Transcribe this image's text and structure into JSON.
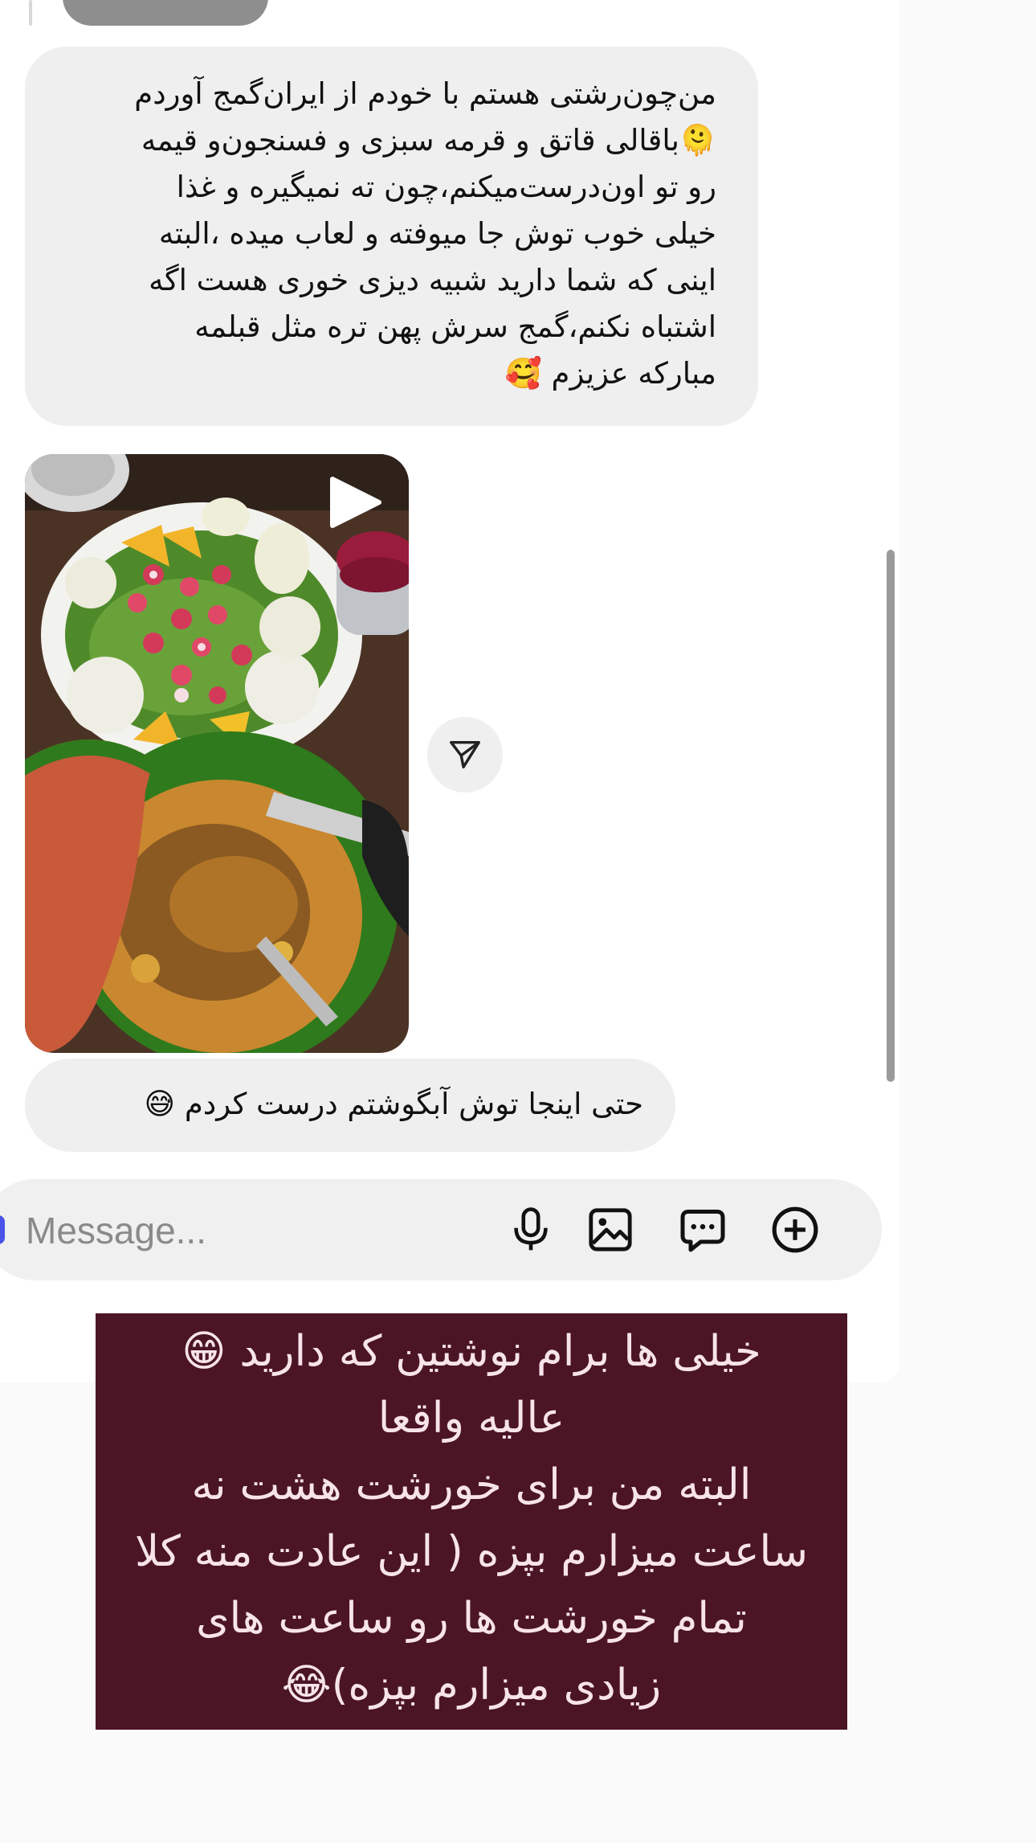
{
  "chat": {
    "messages": [
      {
        "text": "من‌چون‌رشتی هستم با خودم از ایران‌گمج آوردم\n🫠باقالی قاتق و قرمه سبزی و فسنجون‌و قیمه\nرو تو اون‌درست‌میکنم،چون ته نمیگیره و غذا\nخیلی خوب توش جا میوفته و لعاب میده ،البته\nاینی که شما دارید شبیه دیزی خوری هست اگه\nاشتباه نکنم،گمج سرش پهن تره مثل قبلمه\nمبارکه عزیزم 🥰"
      },
      {
        "text": "حتی اینجا توش آبگوشتم درست کردم 😅"
      }
    ],
    "video": {
      "icon": "play-icon",
      "colors": {
        "table": "#4a3325",
        "salad_plate": "#f2f2ee",
        "green_bowl": "#2f7a1c",
        "rice": "#c9872f",
        "ladle": "#c85a3a"
      }
    },
    "share_icon": "send-icon"
  },
  "composer": {
    "placeholder": "Message...",
    "icons": [
      "microphone-icon",
      "gallery-icon",
      "chat-bubble-icon",
      "plus-circle-icon"
    ]
  },
  "caption": {
    "text": "خیلی ها برام نوشتین که دارید 😁\nعالیه واقعا\nالبته من برای خورشت هشت نه\nساعت میزارم بپزه ( این عادت منه کلا\nتمام خورشت ها رو ساعت های\nزیادی میزارم بپزه)😂",
    "background": "#4b1526",
    "color": "#f7e4e9"
  },
  "colors": {
    "bubble": "#efefef",
    "page": "#fafafa",
    "accent": "#4a52e8"
  }
}
